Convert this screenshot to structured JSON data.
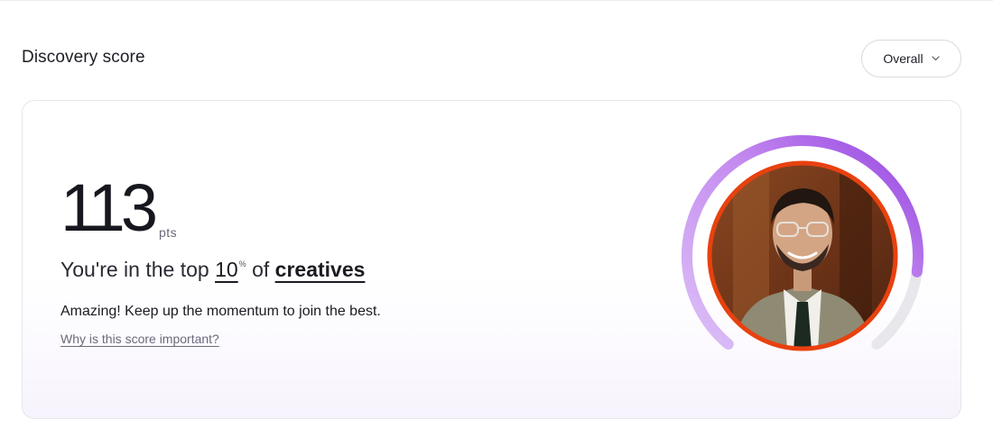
{
  "header": {
    "title": "Discovery score",
    "filter": {
      "selected": "Overall",
      "icon": "chevron-down-icon"
    }
  },
  "score": {
    "value": "113",
    "unit": "pts",
    "rank_prefix": "You're in the top",
    "rank_value": "10",
    "rank_unit": "%",
    "rank_of": "of",
    "rank_group": "creatives",
    "message": "Amazing! Keep up the momentum to join the best.",
    "link": "Why is this score important?",
    "progress_fraction": 0.85
  },
  "colors": {
    "arc_start": "#dcc0f7",
    "arc_mid": "#c58cf0",
    "arc_end": "#9546e0",
    "arc_track": "#e7e7ec",
    "ring": "#e8410f"
  }
}
